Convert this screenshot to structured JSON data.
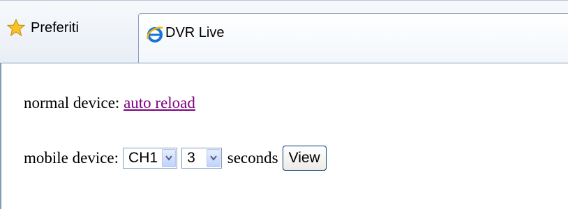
{
  "browser": {
    "favorites_label": "Preferiti",
    "tab_title": "DVR Live"
  },
  "content": {
    "normal_label": "normal device: ",
    "auto_reload_link": "auto reload",
    "mobile_label": "mobile device: ",
    "channel_value": "CH1",
    "interval_value": "3",
    "seconds_label": "seconds",
    "view_button": "View"
  },
  "colors": {
    "link_visited": "#800080",
    "chrome_border": "#7f9db9"
  }
}
